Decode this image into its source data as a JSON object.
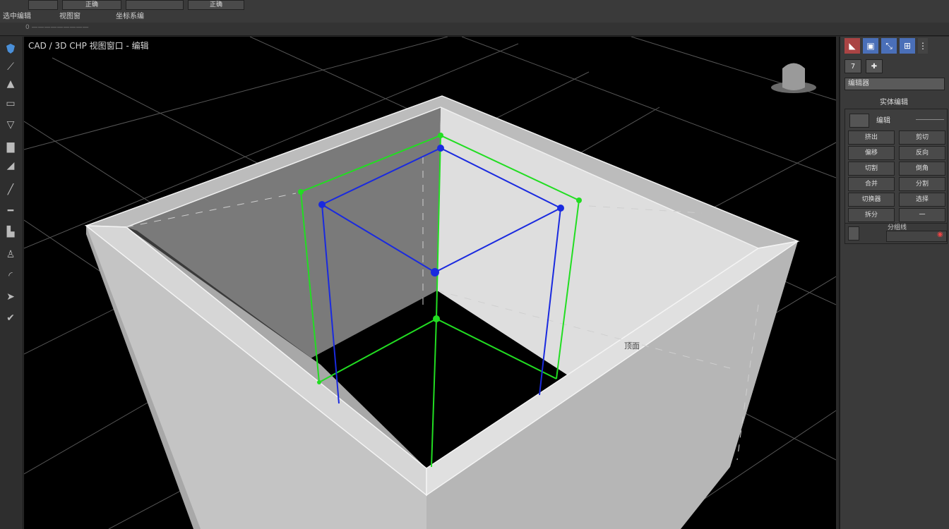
{
  "menubar": {
    "tabs": [
      "",
      "正确",
      "",
      "正确"
    ],
    "items": [
      "选中编辑",
      "视图窗",
      "坐标系编"
    ]
  },
  "subbar": {
    "text": "0 —————————"
  },
  "viewport": {
    "label": "CAD / 3D CHP 视图窗口 - 编辑",
    "inner_label": "顶面",
    "colors": {
      "wire_green": "#22dd22",
      "wire_blue": "#1a2adf"
    }
  },
  "left_toolbar": {
    "icons": [
      "shield-icon",
      "wand-icon",
      "lock-icon",
      "ruler-icon",
      "curve-icon",
      "stamp-icon",
      "bucket-icon",
      "line-icon",
      "minus-icon",
      "building-icon",
      "person-icon",
      "arc-icon",
      "arrow-icon",
      "hand-icon"
    ]
  },
  "right_panel": {
    "row2": [
      "7",
      "✚"
    ],
    "name_field": "编辑器",
    "section_title": "实体编辑",
    "group_title": "编辑",
    "buttons": [
      [
        "挤出",
        "剪切"
      ],
      [
        "偏移",
        "反向"
      ],
      [
        "切割",
        "倒角"
      ],
      [
        "合并",
        "分割"
      ],
      [
        "切换器",
        "选择"
      ],
      [
        "拆分",
        "一"
      ]
    ],
    "bottom_tag": "分组线"
  }
}
